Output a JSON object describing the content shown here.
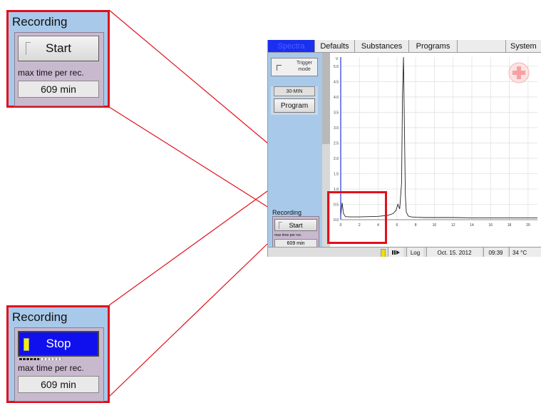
{
  "zoom_start": {
    "title": "Recording",
    "button_label": "Start",
    "max_time_label": "max time per rec.",
    "max_time_value": "609 min"
  },
  "zoom_stop": {
    "title": "Recording",
    "button_label": "Stop",
    "max_time_label": "max time per rec.",
    "max_time_value": "609 min"
  },
  "app": {
    "tabs": [
      "Spectra",
      "Defaults",
      "Substances",
      "Programs",
      "System"
    ],
    "active_tab": "Spectra",
    "sidebar": {
      "trigger_label_1": "Trigger",
      "trigger_label_2": "mode",
      "program_mins": "30-MIN",
      "program_button": "Program",
      "recording_title": "Recording",
      "start_button": "Start",
      "max_time_label": "max time per rec.",
      "max_time_value": "609 min"
    },
    "status": {
      "log_button": "Log",
      "date": "Oct. 15. 2012",
      "time": "09:39",
      "temperature": "34 °C"
    },
    "colors": {
      "accent_blue": "#1a2ff0",
      "highlight_red": "#e0101c",
      "panel_blue": "#a8c9ea"
    }
  },
  "chart_data": {
    "type": "line",
    "title": "",
    "xlabel": "",
    "ylabel": "",
    "y_unit_label": "V",
    "x_tick_labels": [
      "0",
      "2",
      "4",
      "6",
      "8",
      "10",
      "12",
      "14",
      "16",
      "18",
      "20"
    ],
    "y_tick_labels": [
      "0.0",
      "0.5",
      "1.0",
      "1.5",
      "2.0",
      "2.5",
      "3.0",
      "3.5",
      "4.0",
      "4.5",
      "5.0"
    ],
    "xlim": [
      0,
      21
    ],
    "ylim": [
      0,
      5.3
    ],
    "grid": true,
    "series": [
      {
        "x": [
          0,
          0.15,
          0.3,
          0.5,
          1,
          2,
          3,
          4,
          5,
          5.6,
          5.9,
          6.1,
          6.3,
          6.5,
          6.6,
          6.7,
          6.8,
          6.9,
          7.0,
          7.2,
          7.5,
          8,
          9,
          10,
          12,
          14,
          16,
          18,
          20,
          21
        ],
        "y": [
          0.15,
          0.55,
          0.2,
          0.1,
          0.09,
          0.09,
          0.1,
          0.11,
          0.14,
          0.2,
          0.3,
          0.5,
          0.35,
          1.2,
          4.1,
          5.3,
          3.0,
          0.8,
          0.25,
          0.12,
          0.09,
          0.08,
          0.07,
          0.07,
          0.07,
          0.06,
          0.06,
          0.06,
          0.06,
          0.06
        ]
      }
    ]
  }
}
